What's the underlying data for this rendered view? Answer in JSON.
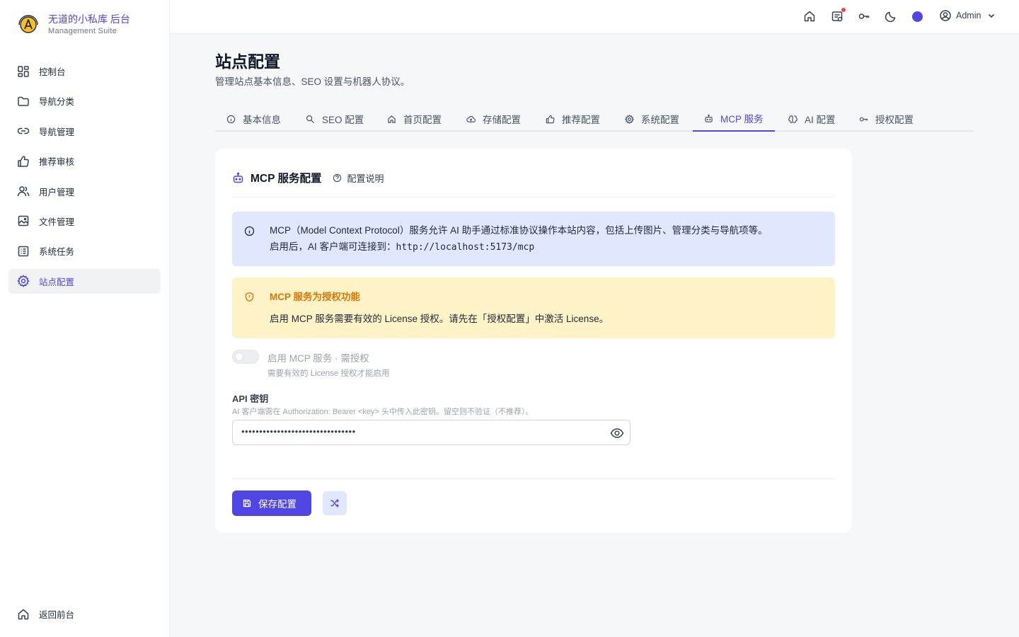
{
  "brand": {
    "title": "无道的小私库 后台",
    "subtitle": "Management Suite"
  },
  "sidebar": {
    "items": [
      {
        "label": "控制台",
        "icon": "dashboard-icon"
      },
      {
        "label": "导航分类",
        "icon": "folder-icon"
      },
      {
        "label": "导航管理",
        "icon": "link-icon"
      },
      {
        "label": "推荐审核",
        "icon": "thumbs-up-icon"
      },
      {
        "label": "用户管理",
        "icon": "users-icon"
      },
      {
        "label": "文件管理",
        "icon": "image-icon"
      },
      {
        "label": "系统任务",
        "icon": "list-icon"
      },
      {
        "label": "站点配置",
        "icon": "gear-icon",
        "active": true
      }
    ],
    "back_label": "返回前台"
  },
  "header": {
    "user_name": "Admin",
    "icons": [
      "home-icon",
      "notification-icon",
      "key-icon",
      "moon-icon",
      "theme-color-dot",
      "user-circle-icon"
    ]
  },
  "page": {
    "title": "站点配置",
    "subtitle": "管理站点基本信息、SEO 设置与机器人协议。"
  },
  "tabs": [
    {
      "label": "基本信息",
      "icon": "info-icon"
    },
    {
      "label": "SEO 配置",
      "icon": "search-icon"
    },
    {
      "label": "首页配置",
      "icon": "home-icon"
    },
    {
      "label": "存储配置",
      "icon": "cloud-icon"
    },
    {
      "label": "推荐配置",
      "icon": "thumbs-up-icon"
    },
    {
      "label": "系统配置",
      "icon": "gear-icon"
    },
    {
      "label": "MCP 服务",
      "icon": "robot-icon",
      "active": true
    },
    {
      "label": "AI 配置",
      "icon": "brain-icon"
    },
    {
      "label": "授权配置",
      "icon": "key-icon"
    }
  ],
  "card": {
    "title": "MCP 服务配置",
    "help_label": "配置说明",
    "info": {
      "line1": "MCP（Model Context Protocol）服务允许 AI 助手通过标准协议操作本站内容，包括上传图片、管理分类与导航项等。",
      "line2_prefix": "启用后，AI 客户端可连接到：",
      "line2_url": "http://localhost:5173/mcp"
    },
    "warning": {
      "title": "MCP 服务为授权功能",
      "body": "启用 MCP 服务需要有效的 License 授权。请先在「授权配置」中激活 License。"
    },
    "toggle": {
      "label": "启用 MCP 服务 · 需授权",
      "hint": "需要有效的 License 授权才能启用",
      "enabled": false
    },
    "api_key": {
      "label": "API 密钥",
      "hint": "AI 客户端需在 Authorization: Bearer <key> 头中传入此密钥。留空则不验证（不推荐）。",
      "value": "••••••••••••••••••••••••••••••••"
    },
    "save_label": "保存配置"
  },
  "colors": {
    "accent": "#4f46e5",
    "info_bg": "#e0e7ff",
    "warn_bg": "#fef3c7",
    "warn_text": "#d97706",
    "notification_dot": "#ef4444"
  }
}
